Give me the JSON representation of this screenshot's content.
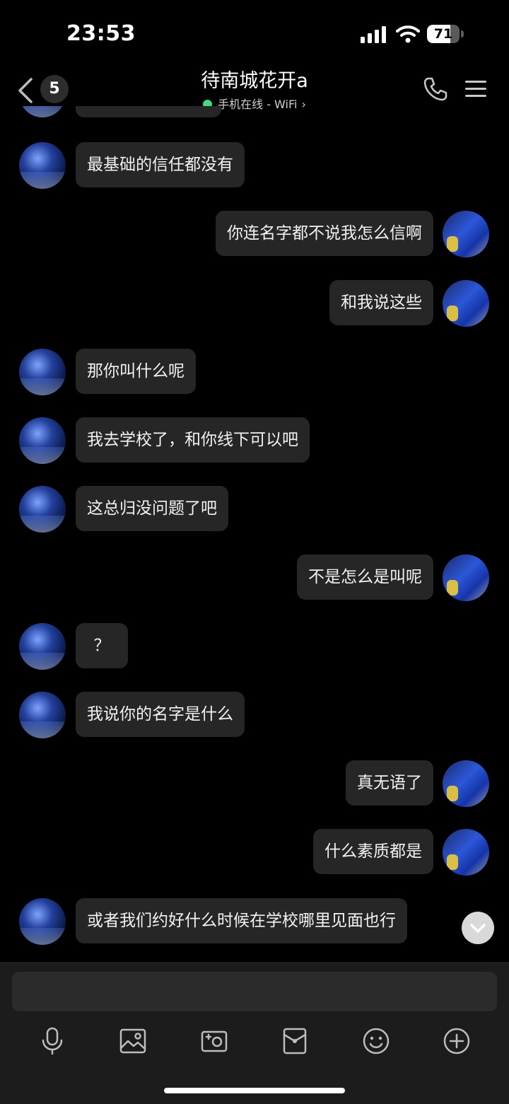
{
  "status_bar": {
    "time": "23:53",
    "battery": "71"
  },
  "header": {
    "unread_count": "5",
    "contact_name": "待南城花开a",
    "online_status": "手机在线 - WiFi"
  },
  "messages": [
    {
      "side": "in",
      "text": "最基础的信任都没有"
    },
    {
      "side": "out",
      "text": "你连名字都不说我怎么信啊"
    },
    {
      "side": "out",
      "text": "和我说这些"
    },
    {
      "side": "in",
      "text": "那你叫什么呢"
    },
    {
      "side": "in",
      "text": "我去学校了，和你线下可以吧"
    },
    {
      "side": "in",
      "text": "这总归没问题了吧"
    },
    {
      "side": "out",
      "text": "不是怎么是叫呢"
    },
    {
      "side": "in",
      "text": "？"
    },
    {
      "side": "in",
      "text": "我说你的名字是什么"
    },
    {
      "side": "out",
      "text": "真无语了"
    },
    {
      "side": "out",
      "text": "什么素质都是"
    },
    {
      "side": "in",
      "text": "或者我们约好什么时候在学校哪里见面也行"
    }
  ],
  "toolbar": {
    "icons": [
      "microphone-icon",
      "image-icon",
      "camera-icon",
      "red-packet-icon",
      "emoji-icon",
      "plus-icon"
    ]
  }
}
